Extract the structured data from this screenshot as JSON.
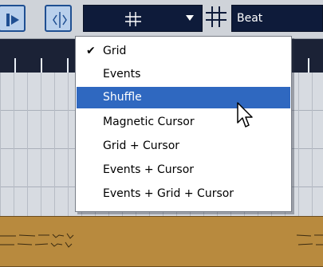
{
  "toolbar": {
    "snap_type_icon": "grid-icon",
    "quantize_icon": "grid-icon",
    "quantize_value": "Beat"
  },
  "snap_menu": {
    "items": [
      {
        "label": "Grid",
        "checked": true,
        "highlighted": false
      },
      {
        "label": "Events",
        "checked": false,
        "highlighted": false
      },
      {
        "label": "Shuffle",
        "checked": false,
        "highlighted": true
      },
      {
        "label": "Magnetic Cursor",
        "checked": false,
        "highlighted": false
      },
      {
        "label": "Grid + Cursor",
        "checked": false,
        "highlighted": false
      },
      {
        "label": "Events + Cursor",
        "checked": false,
        "highlighted": false
      },
      {
        "label": "Events + Grid + Cursor",
        "checked": false,
        "highlighted": false
      }
    ],
    "check_glyph": "✔"
  },
  "colors": {
    "menu_highlight": "#2f68c0",
    "field_background": "#0e1b3a",
    "event_color": "#b88a3e",
    "ruler_background": "#1b2236"
  }
}
